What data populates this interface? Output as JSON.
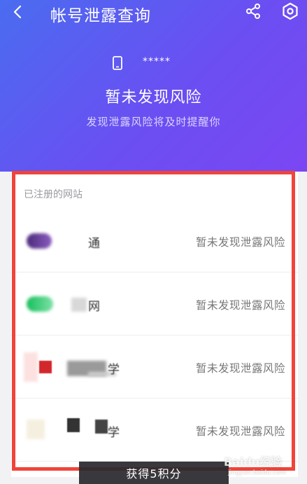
{
  "header": {
    "title": "帐号泄露查询"
  },
  "account": {
    "masked": "*****",
    "status_title": "暂未发现风险",
    "status_subtitle": "发现泄露风险将及时提醒你"
  },
  "sites": {
    "section_label": "已注册的网站",
    "items": [
      {
        "name": "通",
        "risk": "暂未发现泄露风险",
        "logo_color": "#6a3fa0"
      },
      {
        "name": "网",
        "risk": "暂未发现泄露风险",
        "logo_color": "#22c46a"
      },
      {
        "name": "学",
        "risk": "暂未发现泄露风险",
        "logo_color": "#d2282c"
      },
      {
        "name": "学",
        "risk": "暂未发现泄露风险",
        "logo_color": "#444444"
      }
    ]
  },
  "toast": {
    "text": "获得5积分"
  },
  "watermark": {
    "text": "Baidu经验",
    "sub": "jingyan.baidu.com"
  },
  "colors": {
    "hero_start": "#4a6cf0",
    "hero_end": "#7b46f3",
    "highlight": "#f0443a"
  }
}
